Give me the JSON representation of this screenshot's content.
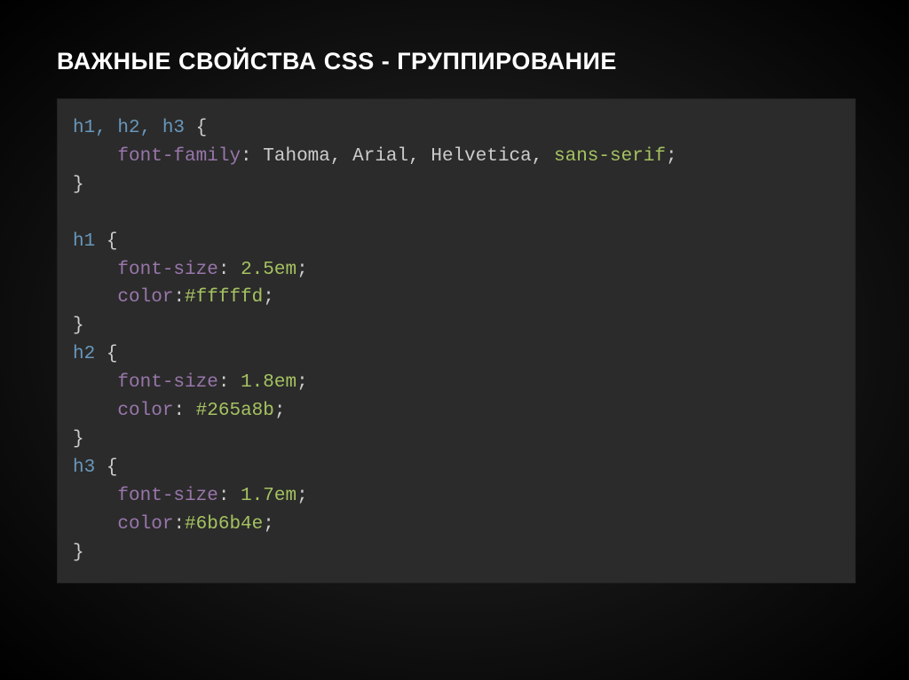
{
  "title": "ВАЖНЫЕ СВОЙСТВА CSS - ГРУППИРОВАНИЕ",
  "code": {
    "r1_sel": "h1, h2, h3",
    "r1_prop1": "font-family",
    "r1_val1_a": "Tahoma",
    "r1_val1_b": "Arial",
    "r1_val1_c": "Helvetica",
    "r1_val1_d": "sans-serif",
    "r2_sel": "h1",
    "r2_prop1": "font-size",
    "r2_val1": "2.5em",
    "r2_prop2": "color",
    "r2_val2": "#fffffd",
    "r3_sel": "h2",
    "r3_prop1": "font-size",
    "r3_val1": "1.8em",
    "r3_prop2": "color",
    "r3_val2": "#265a8b",
    "r4_sel": "h3",
    "r4_prop1": "font-size",
    "r4_val1": "1.7em",
    "r4_prop2": "color",
    "r4_val2": "#6b6b4e"
  }
}
